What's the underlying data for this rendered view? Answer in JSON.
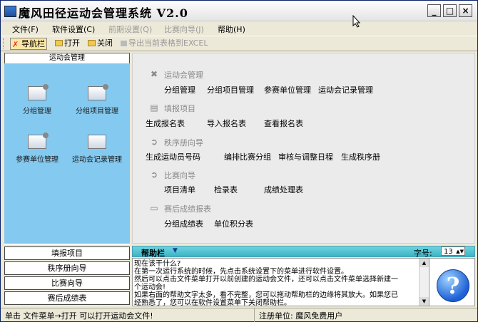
{
  "window": {
    "title": "魔风田径运动会管理系统 V2.0"
  },
  "menus": [
    {
      "label": "文件(F)",
      "enabled": true
    },
    {
      "label": "软件设置(C)",
      "enabled": true
    },
    {
      "label": "前期设置(Q)",
      "enabled": false
    },
    {
      "label": "比赛向导(J)",
      "enabled": false
    },
    {
      "label": "帮助(H)",
      "enabled": true
    }
  ],
  "toolbar": {
    "nav_label": "导航栏",
    "open_label": "打开",
    "close_label": "关闭",
    "export_label": "导出当前表格到EXCEL"
  },
  "nav": {
    "header": "运动会管理",
    "items": [
      "分组管理",
      "分组项目管理",
      "参赛单位管理",
      "运动会记录管理"
    ],
    "buttons": [
      "填报项目",
      "秩序册向导",
      "比赛向导",
      "赛后成绩表"
    ]
  },
  "main": {
    "sections": [
      {
        "title": "运动会管理",
        "links": [
          "分组管理",
          "分组项目管理",
          "参赛单位管理",
          "运动会记录管理"
        ]
      },
      {
        "title": "填报项目",
        "links": [
          "生成报名表",
          "导入报名表",
          "查看报名表"
        ]
      },
      {
        "title": "秩序册向导",
        "links": [
          "生成运动员号码",
          "编排比赛分组",
          "审核与调整日程",
          "生成秩序册"
        ]
      },
      {
        "title": "比赛向导",
        "links": [
          "项目清单",
          "检录表",
          "成绩处理表"
        ]
      },
      {
        "title": "赛后成绩报表",
        "links": [
          "分组成绩表",
          "单位积分表"
        ]
      }
    ]
  },
  "help": {
    "title": "帮助栏",
    "font_label": "字号:",
    "font_value": "13",
    "lines": [
      "现在该干什么?",
      "  在第一次运行系统的时候，先点击系统设置下的菜单进行软件设置。",
      "  然后可以点击文件菜单打开以前创建的运动会文件，还可以点击文件菜单选择新建一",
      "  个运动会!",
      "  如果右面的帮助文字太多，看不完整，您可以拖动帮助栏的边缘将其放大。如果您已",
      "  经熟悉了，您可以在软件设置菜单下关闭帮助栏。"
    ]
  },
  "status": {
    "left": "单击 文件菜单→打开 可以打开运动会文件!",
    "right": "注册单位: 魔风免费用户"
  }
}
